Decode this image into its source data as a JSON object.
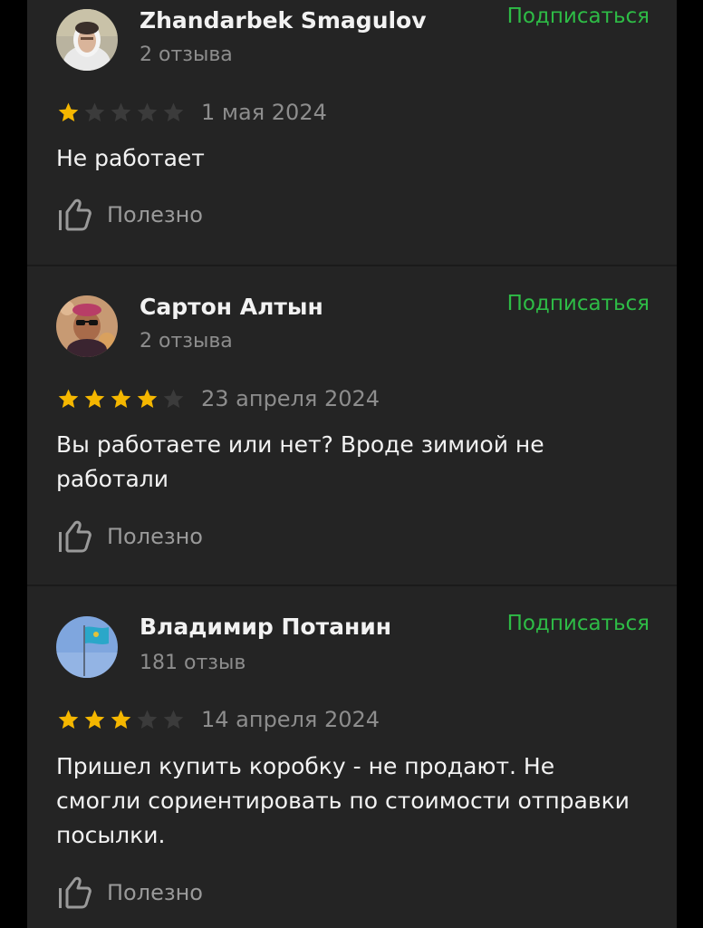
{
  "colors": {
    "background": "#242424",
    "accent": "#2ebc46",
    "star_filled": "#f5b700",
    "star_empty": "#3b3b3b",
    "text_primary": "#f2f2f2",
    "text_secondary": "#8d8d8d"
  },
  "reviews": [
    {
      "author": "Zhandarbek Smagulov",
      "reviews_count": "2 отзыва",
      "subscribe_label": "Подписаться",
      "rating": 1,
      "max_rating": 5,
      "date": "1 мая 2024",
      "text": "Не работает",
      "useful_label": "Полезно",
      "avatar_icon": "avatar-photo-person-white-hood"
    },
    {
      "author": "Сартон Алтын",
      "reviews_count": "2 отзыва",
      "subscribe_label": "Подписаться",
      "rating": 4,
      "max_rating": 5,
      "date": "23 апреля 2024",
      "text": "Вы работаете или нет? Вроде зимиой не работали",
      "useful_label": "Полезно",
      "avatar_icon": "avatar-photo-person-sunglasses"
    },
    {
      "author": "Владимир Потанин",
      "reviews_count": "181 отзыв",
      "subscribe_label": "Подписаться",
      "rating": 3,
      "max_rating": 5,
      "date": "14 апреля 2024",
      "text": "Пришел купить коробку - не продают. Не смогли сориентировать по стоимости отправки посылки.",
      "useful_label": "Полезно",
      "avatar_icon": "avatar-photo-kazakhstan-flag"
    }
  ]
}
